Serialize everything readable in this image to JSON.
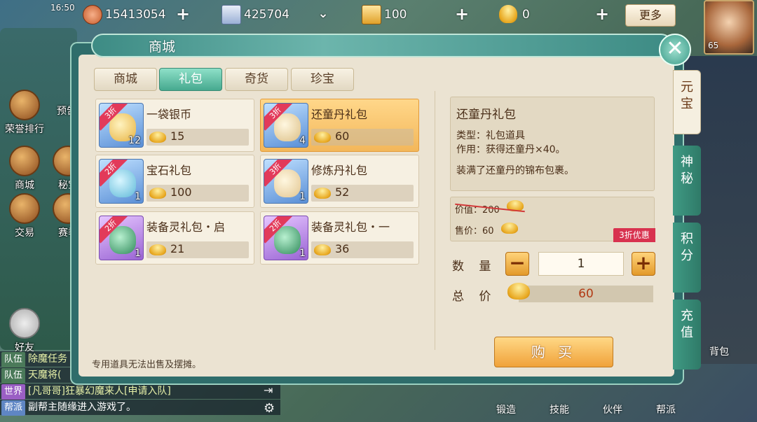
{
  "status": {
    "time": "16:50"
  },
  "resources": [
    {
      "icon": "copper-coin-icon",
      "value": "15413054"
    },
    {
      "icon": "scroll-icon",
      "value": "425704"
    },
    {
      "icon": "ticket-icon",
      "value": "100"
    },
    {
      "icon": "gold-ingot-icon",
      "value": "0"
    }
  ],
  "top": {
    "more_label": "更多",
    "avatar_level": "65"
  },
  "left_nav": [
    "荣誉排行",
    "预告",
    "商城",
    "秘宝",
    "交易",
    "赛季",
    "好友"
  ],
  "chat": [
    {
      "channel": "队伍",
      "text": "除魔任务",
      "color": "#4b7a5a"
    },
    {
      "channel": "队伍",
      "text": "天魔将(",
      "color": "#4b7a5a"
    },
    {
      "channel": "世界",
      "text": "[凡哥哥]狂暴幻魔来人[申请入队]",
      "color": "#9a5fc4"
    },
    {
      "channel": "帮派",
      "text": "副帮主随缘进入游戏了。",
      "color": "#5f86c4"
    }
  ],
  "bottom_menu": [
    "锻造",
    "技能",
    "伙伴",
    "帮派",
    "背包"
  ],
  "shop": {
    "title": "商城",
    "tabs": [
      "商城",
      "礼包",
      "奇货",
      "珍宝"
    ],
    "active_tab": 1,
    "items": [
      {
        "name": "一袋银币",
        "discount": "3折",
        "qty": "12",
        "price": "15",
        "theme": "blue"
      },
      {
        "name": "还童丹礼包",
        "discount": "3折",
        "qty": "4",
        "price": "60",
        "theme": "blue",
        "selected": true
      },
      {
        "name": "宝石礼包",
        "discount": "2折",
        "qty": "1",
        "price": "100",
        "theme": "blue"
      },
      {
        "name": "修炼丹礼包",
        "discount": "3折",
        "qty": "1",
        "price": "52",
        "theme": "blue"
      },
      {
        "name": "装备灵礼包・启",
        "discount": "2折",
        "qty": "1",
        "price": "21",
        "theme": "purple"
      },
      {
        "name": "装备灵礼包・一",
        "discount": "2折",
        "qty": "1",
        "price": "36",
        "theme": "purple"
      }
    ],
    "note": "专用道具无法出售及摆摊。",
    "detail": {
      "title": "还童丹礼包",
      "type_line": "类型：礼包道具",
      "effect_line": "作用：获得还童丹×40。",
      "desc": "装满了还童丹的锦布包裹。",
      "original_price": "价值：200",
      "sale_price": "售价：60",
      "discount_tag": "3折优惠",
      "qty_label": "数 量",
      "quantity": "1",
      "total_label": "总 价",
      "total": "60",
      "buy_label": "购 买"
    },
    "side_tabs": [
      "元宝",
      "神秘",
      "积分",
      "充值"
    ],
    "active_side_tab": 0
  }
}
